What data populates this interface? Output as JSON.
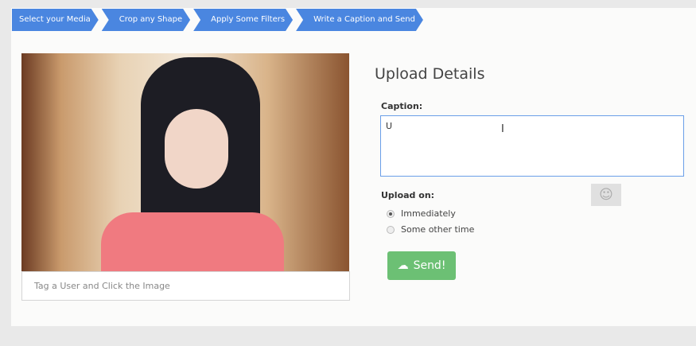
{
  "steps": [
    "Select your Media",
    "Crop any Shape",
    "Apply Some Filters",
    "Write a Caption and Send"
  ],
  "tag_placeholder": "Tag a User and Click the Image",
  "title": "Upload Details",
  "caption_label": "Caption:",
  "caption_value": "U",
  "upload_on_label": "Upload on:",
  "options": [
    "Immediately",
    "Some other time"
  ],
  "selected": "Immediately",
  "send_label": "Send!"
}
